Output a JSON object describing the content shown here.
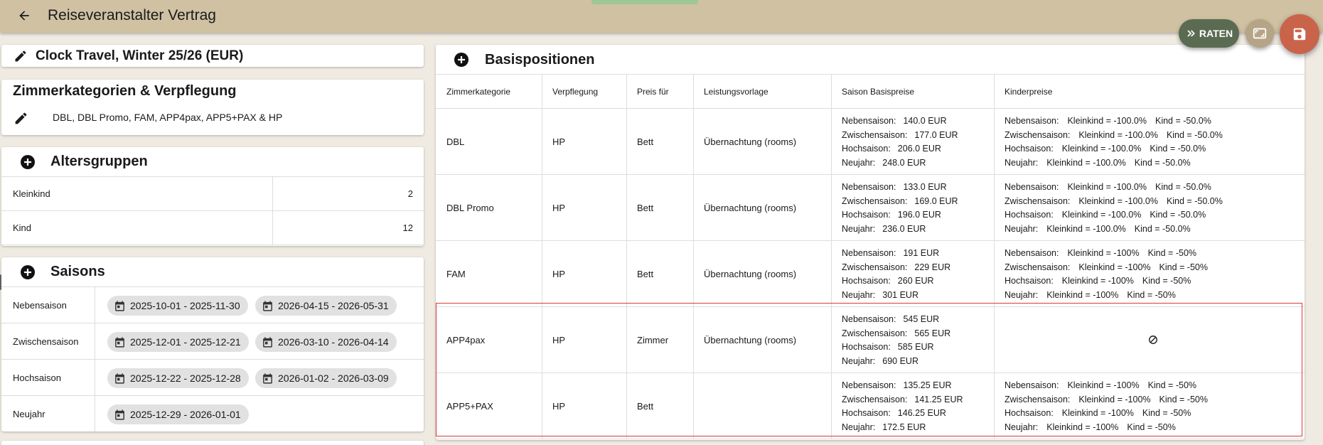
{
  "topbar": {
    "title": "Reiseveranstalter Vertrag"
  },
  "fabs": {
    "raten_label": "RATEN"
  },
  "contract": {
    "title": "Clock Travel, Winter 25/26 (EUR)"
  },
  "zimmer": {
    "title": "Zimmerkategorien & Verpflegung",
    "list": "DBL, DBL Promo, FAM, APP4pax, APP5+PAX & HP"
  },
  "altersgruppen": {
    "title": "Altersgruppen",
    "rows": [
      {
        "label": "Kleinkind",
        "value": "2"
      },
      {
        "label": "Kind",
        "value": "12"
      }
    ]
  },
  "saisons": {
    "title": "Saisons",
    "rows": [
      {
        "label": "Nebensaison",
        "ranges": [
          "2025-10-01 - 2025-11-30",
          "2026-04-15 - 2026-05-31"
        ]
      },
      {
        "label": "Zwischensaison",
        "ranges": [
          "2025-12-01 - 2025-12-21",
          "2026-03-10 - 2026-04-14"
        ]
      },
      {
        "label": "Hochsaison",
        "ranges": [
          "2025-12-22 - 2025-12-28",
          "2026-01-02 - 2026-03-09"
        ]
      },
      {
        "label": "Neujahr",
        "ranges": [
          "2025-12-29 - 2026-01-01"
        ]
      }
    ]
  },
  "basis": {
    "title": "Basispositionen",
    "headers": [
      "Zimmerkategorie",
      "Verpflegung",
      "Preis für",
      "Leistungsvorlage",
      "Saison Basispreise",
      "Kinderpreise"
    ],
    "rows": [
      {
        "zimmer": "DBL",
        "verpflegung": "HP",
        "preis_fuer": "Bett",
        "leistung": "Übernachtung (rooms)",
        "preise": [
          {
            "saison": "Nebensaison:",
            "wert": "140.0 EUR"
          },
          {
            "saison": "Zwischensaison:",
            "wert": "177.0 EUR"
          },
          {
            "saison": "Hochsaison:",
            "wert": "206.0 EUR"
          },
          {
            "saison": "Neujahr:",
            "wert": "248.0 EUR"
          }
        ],
        "kinder": [
          {
            "saison": "Nebensaison:",
            "kleinkind": "Kleinkind = -100.0%",
            "kind": "Kind = -50.0%"
          },
          {
            "saison": "Zwischensaison:",
            "kleinkind": "Kleinkind = -100.0%",
            "kind": "Kind = -50.0%"
          },
          {
            "saison": "Hochsaison:",
            "kleinkind": "Kleinkind = -100.0%",
            "kind": "Kind = -50.0%"
          },
          {
            "saison": "Neujahr:",
            "kleinkind": "Kleinkind = -100.0%",
            "kind": "Kind = -50.0%"
          }
        ]
      },
      {
        "zimmer": "DBL Promo",
        "verpflegung": "HP",
        "preis_fuer": "Bett",
        "leistung": "Übernachtung (rooms)",
        "preise": [
          {
            "saison": "Nebensaison:",
            "wert": "133.0 EUR"
          },
          {
            "saison": "Zwischensaison:",
            "wert": "169.0 EUR"
          },
          {
            "saison": "Hochsaison:",
            "wert": "196.0 EUR"
          },
          {
            "saison": "Neujahr:",
            "wert": "236.0 EUR"
          }
        ],
        "kinder": [
          {
            "saison": "Nebensaison:",
            "kleinkind": "Kleinkind = -100.0%",
            "kind": "Kind = -50.0%"
          },
          {
            "saison": "Zwischensaison:",
            "kleinkind": "Kleinkind = -100.0%",
            "kind": "Kind = -50.0%"
          },
          {
            "saison": "Hochsaison:",
            "kleinkind": "Kleinkind = -100.0%",
            "kind": "Kind = -50.0%"
          },
          {
            "saison": "Neujahr:",
            "kleinkind": "Kleinkind = -100.0%",
            "kind": "Kind = -50.0%"
          }
        ]
      },
      {
        "zimmer": "FAM",
        "verpflegung": "HP",
        "preis_fuer": "Bett",
        "leistung": "Übernachtung (rooms)",
        "preise": [
          {
            "saison": "Nebensaison:",
            "wert": "191 EUR"
          },
          {
            "saison": "Zwischensaison:",
            "wert": "229 EUR"
          },
          {
            "saison": "Hochsaison:",
            "wert": "260 EUR"
          },
          {
            "saison": "Neujahr:",
            "wert": "301 EUR"
          }
        ],
        "kinder": [
          {
            "saison": "Nebensaison:",
            "kleinkind": "Kleinkind = -100%",
            "kind": "Kind = -50%"
          },
          {
            "saison": "Zwischensaison:",
            "kleinkind": "Kleinkind = -100%",
            "kind": "Kind = -50%"
          },
          {
            "saison": "Hochsaison:",
            "kleinkind": "Kleinkind = -100%",
            "kind": "Kind = -50%"
          },
          {
            "saison": "Neujahr:",
            "kleinkind": "Kleinkind = -100%",
            "kind": "Kind = -50%"
          }
        ]
      },
      {
        "zimmer": "APP4pax",
        "verpflegung": "HP",
        "preis_fuer": "Zimmer",
        "leistung": "Übernachtung (rooms)",
        "preise": [
          {
            "saison": "Nebensaison:",
            "wert": "545 EUR"
          },
          {
            "saison": "Zwischensaison:",
            "wert": "565 EUR"
          },
          {
            "saison": "Hochsaison:",
            "wert": "585 EUR"
          },
          {
            "saison": "Neujahr:",
            "wert": "690 EUR"
          }
        ],
        "kinder": []
      },
      {
        "zimmer": "APP5+PAX",
        "verpflegung": "HP",
        "preis_fuer": "Bett",
        "leistung": "",
        "preise": [
          {
            "saison": "Nebensaison:",
            "wert": "135.25 EUR"
          },
          {
            "saison": "Zwischensaison:",
            "wert": "141.25 EUR"
          },
          {
            "saison": "Hochsaison:",
            "wert": "146.25 EUR"
          },
          {
            "saison": "Neujahr:",
            "wert": "172.5 EUR"
          }
        ],
        "kinder": [
          {
            "saison": "Nebensaison:",
            "kleinkind": "Kleinkind = -100%",
            "kind": "Kind = -50%"
          },
          {
            "saison": "Zwischensaison:",
            "kleinkind": "Kleinkind = -100%",
            "kind": "Kind = -50%"
          },
          {
            "saison": "Hochsaison:",
            "kleinkind": "Kleinkind = -100%",
            "kind": "Kind = -50%"
          },
          {
            "saison": "Neujahr:",
            "kleinkind": "Kleinkind = -100%",
            "kind": "Kind = -50%"
          }
        ]
      }
    ]
  }
}
